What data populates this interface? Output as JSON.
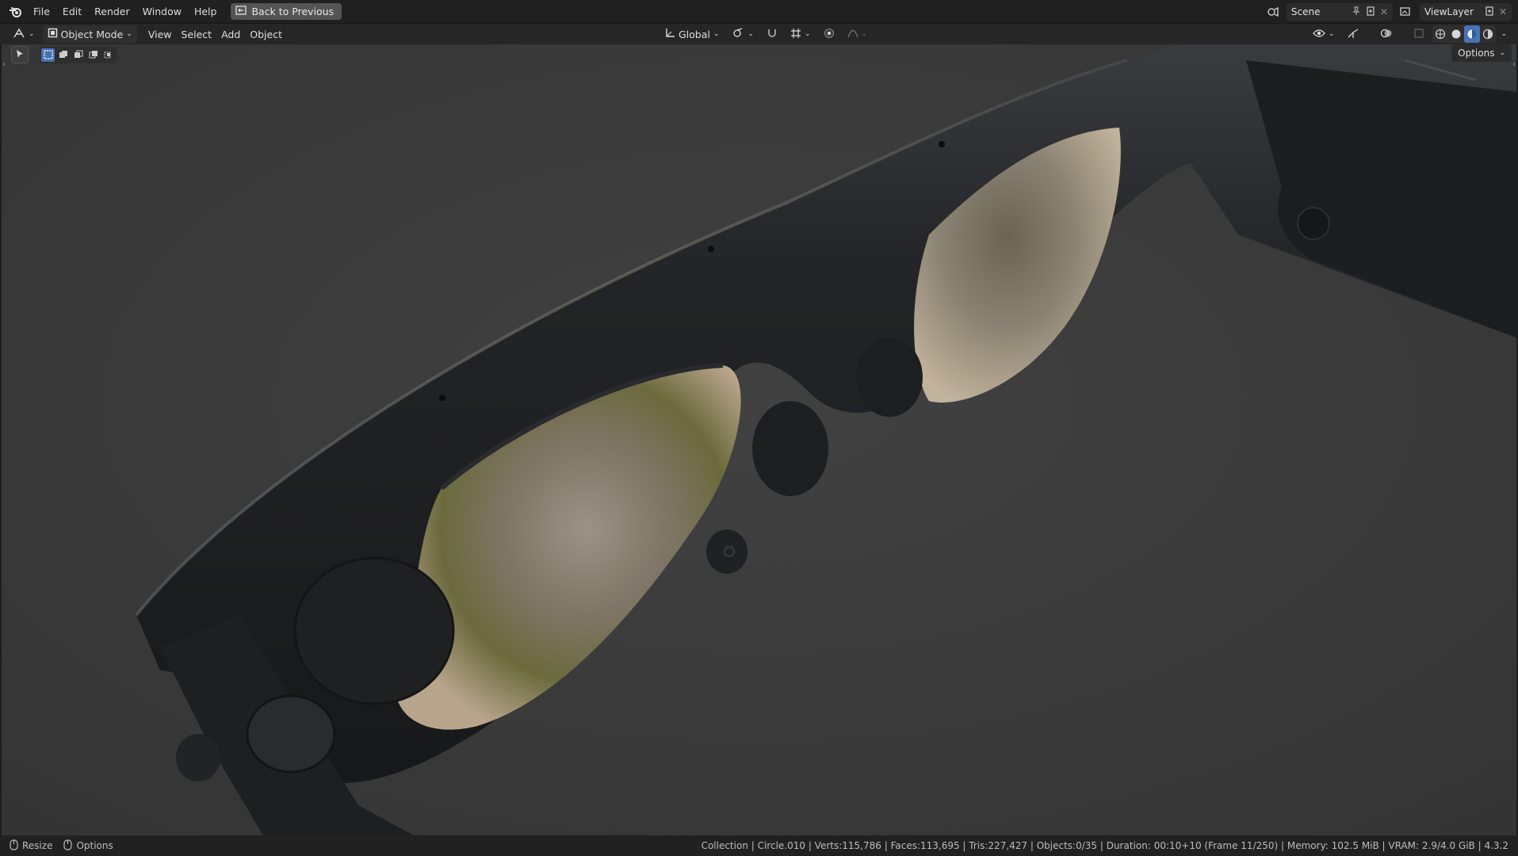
{
  "topbar": {
    "menus": [
      "File",
      "Edit",
      "Render",
      "Window",
      "Help"
    ],
    "back_button": "Back to Previous",
    "scene": "Scene",
    "view_layer": "ViewLayer"
  },
  "viewport_header": {
    "mode": "Object Mode",
    "menus": [
      "View",
      "Select",
      "Add",
      "Object"
    ],
    "orientation": "Global",
    "options": "Options"
  },
  "statusbar": {
    "left": [
      {
        "icon": "mouse-icon",
        "label": "Resize"
      },
      {
        "icon": "mouse-icon",
        "label": "Options"
      }
    ],
    "stats": "Collection | Circle.010 | Verts:115,786 | Faces:113,695 | Tris:227,427 | Objects:0/35 | Duration: 00:10+10 (Frame 11/250) | Memory: 102.5 MiB | VRAM: 2.9/4.0 GiB | 4.3.2"
  },
  "colors": {
    "accent": "#4772b3",
    "viewport_bg": "#3a3a3a",
    "frame": "#1f2022"
  }
}
